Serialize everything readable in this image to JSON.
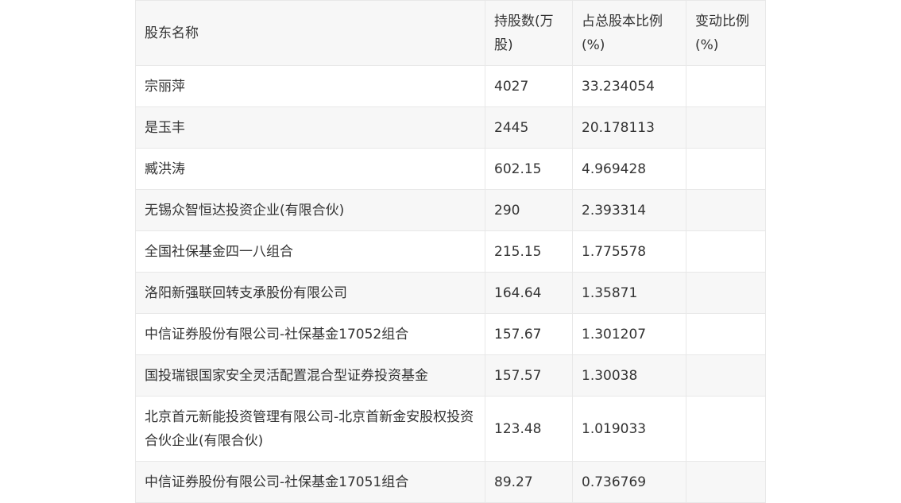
{
  "table": {
    "headers": {
      "name": "股东名称",
      "shares": "持股数(万股)",
      "ratio": "占总股本比例(%)",
      "change": "变动比例(%)"
    },
    "rows": [
      {
        "name": "宗丽萍",
        "shares": "4027",
        "ratio": "33.234054",
        "change": ""
      },
      {
        "name": "是玉丰",
        "shares": "2445",
        "ratio": "20.178113",
        "change": ""
      },
      {
        "name": "臧洪涛",
        "shares": "602.15",
        "ratio": "4.969428",
        "change": ""
      },
      {
        "name": "无锡众智恒达投资企业(有限合伙)",
        "shares": "290",
        "ratio": "2.393314",
        "change": ""
      },
      {
        "name": "全国社保基金四一八组合",
        "shares": "215.15",
        "ratio": "1.775578",
        "change": ""
      },
      {
        "name": "洛阳新强联回转支承股份有限公司",
        "shares": "164.64",
        "ratio": "1.35871",
        "change": ""
      },
      {
        "name": "中信证券股份有限公司-社保基金17052组合",
        "shares": "157.67",
        "ratio": "1.301207",
        "change": ""
      },
      {
        "name": "国投瑞银国家安全灵活配置混合型证券投资基金",
        "shares": "157.57",
        "ratio": "1.30038",
        "change": ""
      },
      {
        "name": "北京首元新能投资管理有限公司-北京首新金安股权投资合伙企业(有限合伙)",
        "shares": "123.48",
        "ratio": "1.019033",
        "change": ""
      },
      {
        "name": "中信证券股份有限公司-社保基金17051组合",
        "shares": "89.27",
        "ratio": "0.736769",
        "change": ""
      }
    ]
  }
}
